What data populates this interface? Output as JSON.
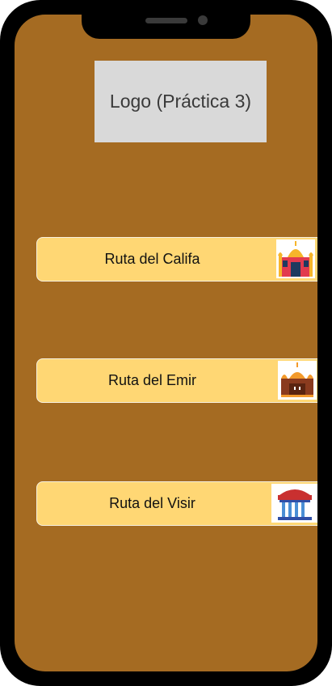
{
  "logo": {
    "text": "Logo (Práctica 3)"
  },
  "routes": [
    {
      "label": "Ruta del Califa",
      "icon": "taj-mahal-icon"
    },
    {
      "label": "Ruta del Emir",
      "icon": "palace-icon"
    },
    {
      "label": "Ruta del Visir",
      "icon": "pavilion-icon"
    }
  ],
  "colors": {
    "background": "#a56b22",
    "button": "#ffd774",
    "logo_box": "#d9d9d9"
  }
}
